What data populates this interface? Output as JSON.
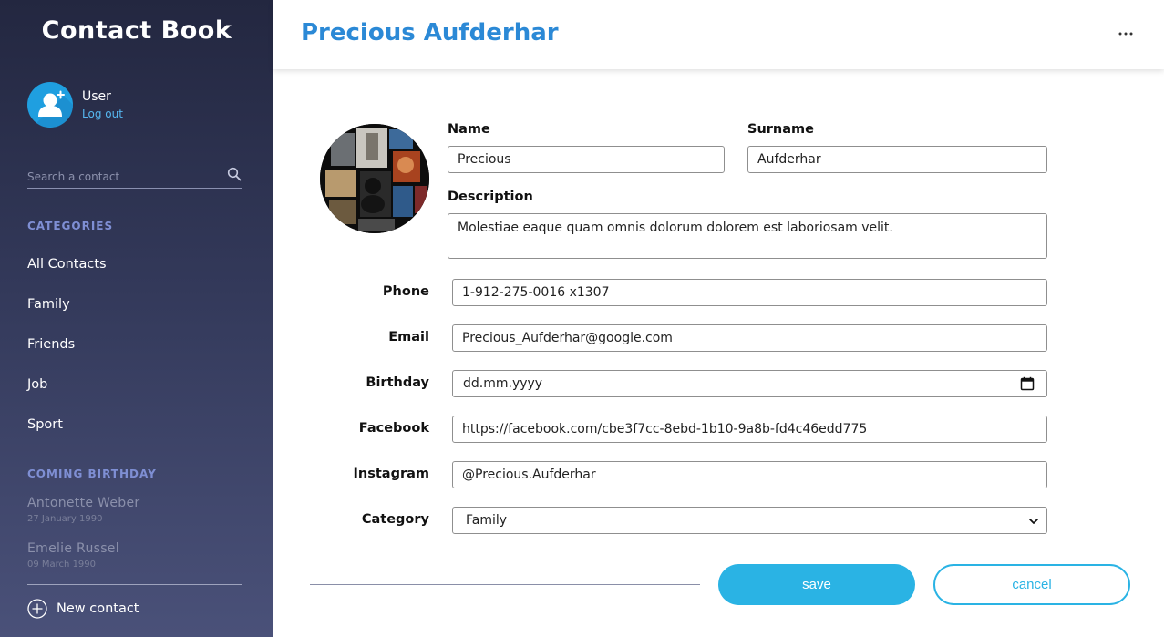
{
  "app": {
    "title": "Contact Book"
  },
  "user": {
    "name": "User",
    "logout_label": "Log out"
  },
  "search": {
    "placeholder": "Search a contact"
  },
  "categories": {
    "heading": "CATEGORIES",
    "items": [
      "All Contacts",
      "Family",
      "Friends",
      "Job",
      "Sport"
    ]
  },
  "birthdays": {
    "heading": "COMING BIRTHDAY",
    "items": [
      {
        "name": "Antonette Weber",
        "date": "27 January 1990"
      },
      {
        "name": "Emelie Russel",
        "date": "09 March 1990"
      }
    ]
  },
  "new_contact_label": "New contact",
  "contact": {
    "title": "Precious Aufderhar",
    "labels": {
      "name": "Name",
      "surname": "Surname",
      "description": "Description",
      "phone": "Phone",
      "email": "Email",
      "birthday": "Birthday",
      "facebook": "Facebook",
      "instagram": "Instagram",
      "category": "Category"
    },
    "values": {
      "name": "Precious",
      "surname": "Aufderhar",
      "description": "Molestiae eaque quam omnis dolorum dolorem est laboriosam velit.",
      "phone": "1-912-275-0016 x1307",
      "email": "Precious_Aufderhar@google.com",
      "birthday_placeholder": "dd.mm.yyyy",
      "facebook": "https://facebook.com/cbe3f7cc-8ebd-1b10-9a8b-fd4c46edd775",
      "instagram": "@Precious.Aufderhar",
      "category": "Family"
    }
  },
  "buttons": {
    "save": "save",
    "cancel": "cancel"
  },
  "icons": {
    "search": "search-icon",
    "more": "more-icon",
    "add_user": "add-user-icon",
    "plus_circle": "plus-circle-icon",
    "calendar": "calendar-icon",
    "chevron": "chevron-down-icon"
  },
  "colors": {
    "accent": "#2ab3e4",
    "title_blue": "#2b89d6",
    "sidebar_top": "#232740",
    "sidebar_bottom": "#4a5179",
    "category_label": "#7f8fd4"
  }
}
